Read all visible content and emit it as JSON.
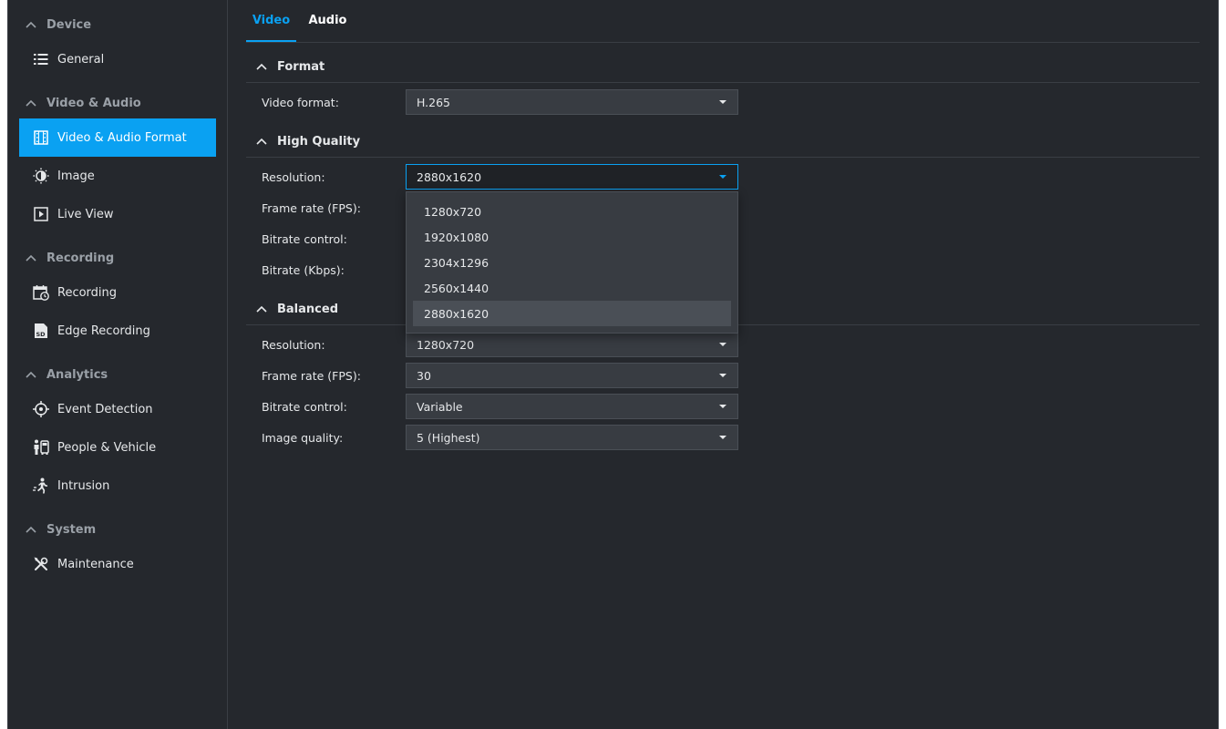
{
  "sidebar": {
    "sections": [
      {
        "label": "Device",
        "items": [
          {
            "label": "General",
            "icon": "list-icon"
          }
        ]
      },
      {
        "label": "Video & Audio",
        "items": [
          {
            "label": "Video & Audio Format",
            "icon": "film-icon",
            "active": true
          },
          {
            "label": "Image",
            "icon": "brightness-icon"
          },
          {
            "label": "Live View",
            "icon": "play-icon"
          }
        ]
      },
      {
        "label": "Recording",
        "items": [
          {
            "label": "Recording",
            "icon": "calendar-clock-icon"
          },
          {
            "label": "Edge Recording",
            "icon": "sd-card-icon"
          }
        ]
      },
      {
        "label": "Analytics",
        "items": [
          {
            "label": "Event Detection",
            "icon": "crosshair-icon"
          },
          {
            "label": "People & Vehicle",
            "icon": "people-vehicle-icon"
          },
          {
            "label": "Intrusion",
            "icon": "running-person-icon"
          }
        ]
      },
      {
        "label": "System",
        "items": [
          {
            "label": "Maintenance",
            "icon": "tools-icon"
          }
        ]
      }
    ]
  },
  "tabs": [
    {
      "label": "Video",
      "active": true
    },
    {
      "label": "Audio",
      "active": false
    }
  ],
  "format": {
    "title": "Format",
    "video_format_label": "Video format:",
    "video_format_value": "H.265"
  },
  "high_quality": {
    "title": "High Quality",
    "resolution_label": "Resolution:",
    "resolution_value": "2880x1620",
    "frame_rate_label": "Frame rate (FPS):",
    "bitrate_control_label": "Bitrate control:",
    "bitrate_label": "Bitrate (Kbps):"
  },
  "resolution_dropdown": {
    "options": [
      "1280x720",
      "1920x1080",
      "2304x1296",
      "2560x1440",
      "2880x1620"
    ],
    "highlighted": "2880x1620"
  },
  "balanced": {
    "title": "Balanced",
    "resolution_label": "Resolution:",
    "resolution_value": "1280x720",
    "frame_rate_label": "Frame rate (FPS):",
    "frame_rate_value": "30",
    "bitrate_control_label": "Bitrate control:",
    "bitrate_control_value": "Variable",
    "image_quality_label": "Image quality:",
    "image_quality_value": "5 (Highest)"
  },
  "colors": {
    "accent": "#0aa1f2",
    "background": "#25282d",
    "input_bg": "#383c42"
  }
}
